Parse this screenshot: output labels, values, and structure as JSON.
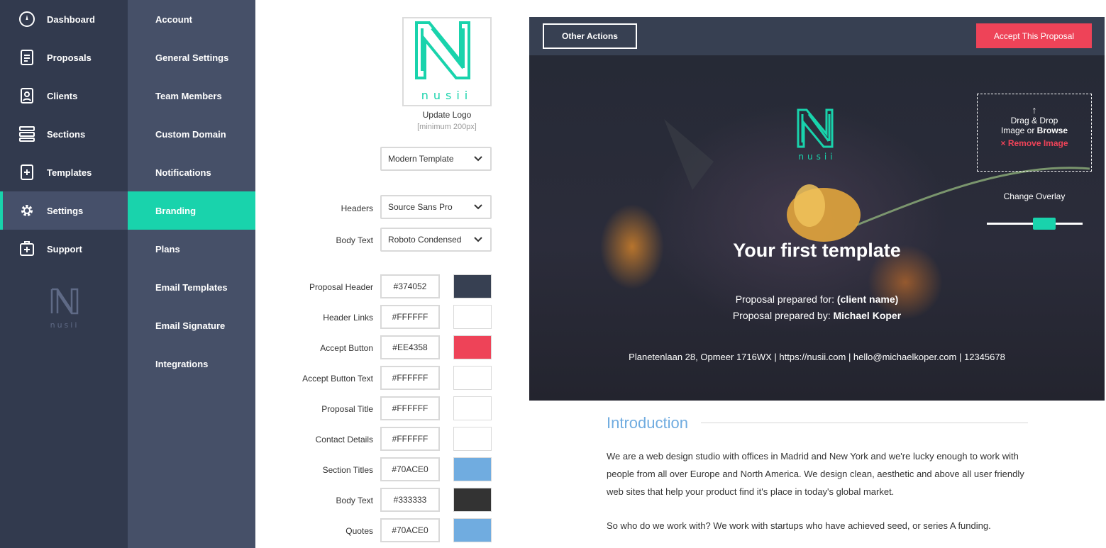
{
  "nav": {
    "items": [
      {
        "label": "Dashboard",
        "icon": "dashboard-icon"
      },
      {
        "label": "Proposals",
        "icon": "proposals-icon"
      },
      {
        "label": "Clients",
        "icon": "clients-icon"
      },
      {
        "label": "Sections",
        "icon": "sections-icon"
      },
      {
        "label": "Templates",
        "icon": "templates-icon"
      },
      {
        "label": "Settings",
        "icon": "gear-icon"
      },
      {
        "label": "Support",
        "icon": "support-icon"
      }
    ],
    "active": "Settings",
    "logo_text": "nusii"
  },
  "submenu": {
    "items": [
      "Account",
      "General Settings",
      "Team Members",
      "Custom Domain",
      "Notifications",
      "Branding",
      "Plans",
      "Email Templates",
      "Email Signature",
      "Integrations"
    ],
    "active": "Branding"
  },
  "branding": {
    "logo_text": "nusii",
    "update_logo": "Update Logo",
    "logo_hint": "[minimum 200px]",
    "template_select": "Modern Template",
    "headers_label": "Headers",
    "headers_font": "Source Sans Pro",
    "body_text_label": "Body Text",
    "body_font": "Roboto Condensed",
    "colors": [
      {
        "label": "Proposal Header",
        "hex": "#374052",
        "swatch": "#374052"
      },
      {
        "label": "Header Links",
        "hex": "#FFFFFF",
        "swatch": "#FFFFFF"
      },
      {
        "label": "Accept Button",
        "hex": "#EE4358",
        "swatch": "#EE4358"
      },
      {
        "label": "Accept Button Text",
        "hex": "#FFFFFF",
        "swatch": "#FFFFFF"
      },
      {
        "label": "Proposal Title",
        "hex": "#FFFFFF",
        "swatch": "#FFFFFF"
      },
      {
        "label": "Contact Details",
        "hex": "#FFFFFF",
        "swatch": "#FFFFFF"
      },
      {
        "label": "Section Titles",
        "hex": "#70ACE0",
        "swatch": "#70ACE0"
      },
      {
        "label": "Body Text",
        "hex": "#333333",
        "swatch": "#333333"
      },
      {
        "label": "Quotes",
        "hex": "#70ACE0",
        "swatch": "#70ACE0"
      }
    ]
  },
  "preview": {
    "other_actions": "Other Actions",
    "accept": "Accept This Proposal",
    "logo_text": "nusii",
    "dropzone_line1": "Drag & Drop",
    "dropzone_line2_a": "Image or ",
    "dropzone_line2_b": "Browse",
    "remove_image": "Remove Image",
    "change_overlay": "Change Overlay",
    "overlay_level": 0.6,
    "title": "Your first template",
    "prepared_for_label": "Proposal prepared for: ",
    "prepared_for_value": "(client name)",
    "prepared_by_label": "Proposal prepared by: ",
    "prepared_by_value": "Michael Koper",
    "contact_line": "Planetenlaan 28, Opmeer 1716WX | https://nusii.com | hello@michaelkoper.com | 12345678",
    "intro_title": "Introduction",
    "intro_p1": "We are a web design studio with offices in Madrid and New York and we're lucky enough to work with people from all over Europe and North America. We design clean, aesthetic and above all user friendly web sites that help your product find it's place in today's global market.",
    "intro_p2": "So who do we work with? We work with startups who have achieved seed, or series A funding."
  },
  "colors": {
    "accent": "#19d3ac",
    "nav_bg": "#323a4e",
    "sub_bg": "#465068",
    "accept": "#ee4358"
  }
}
